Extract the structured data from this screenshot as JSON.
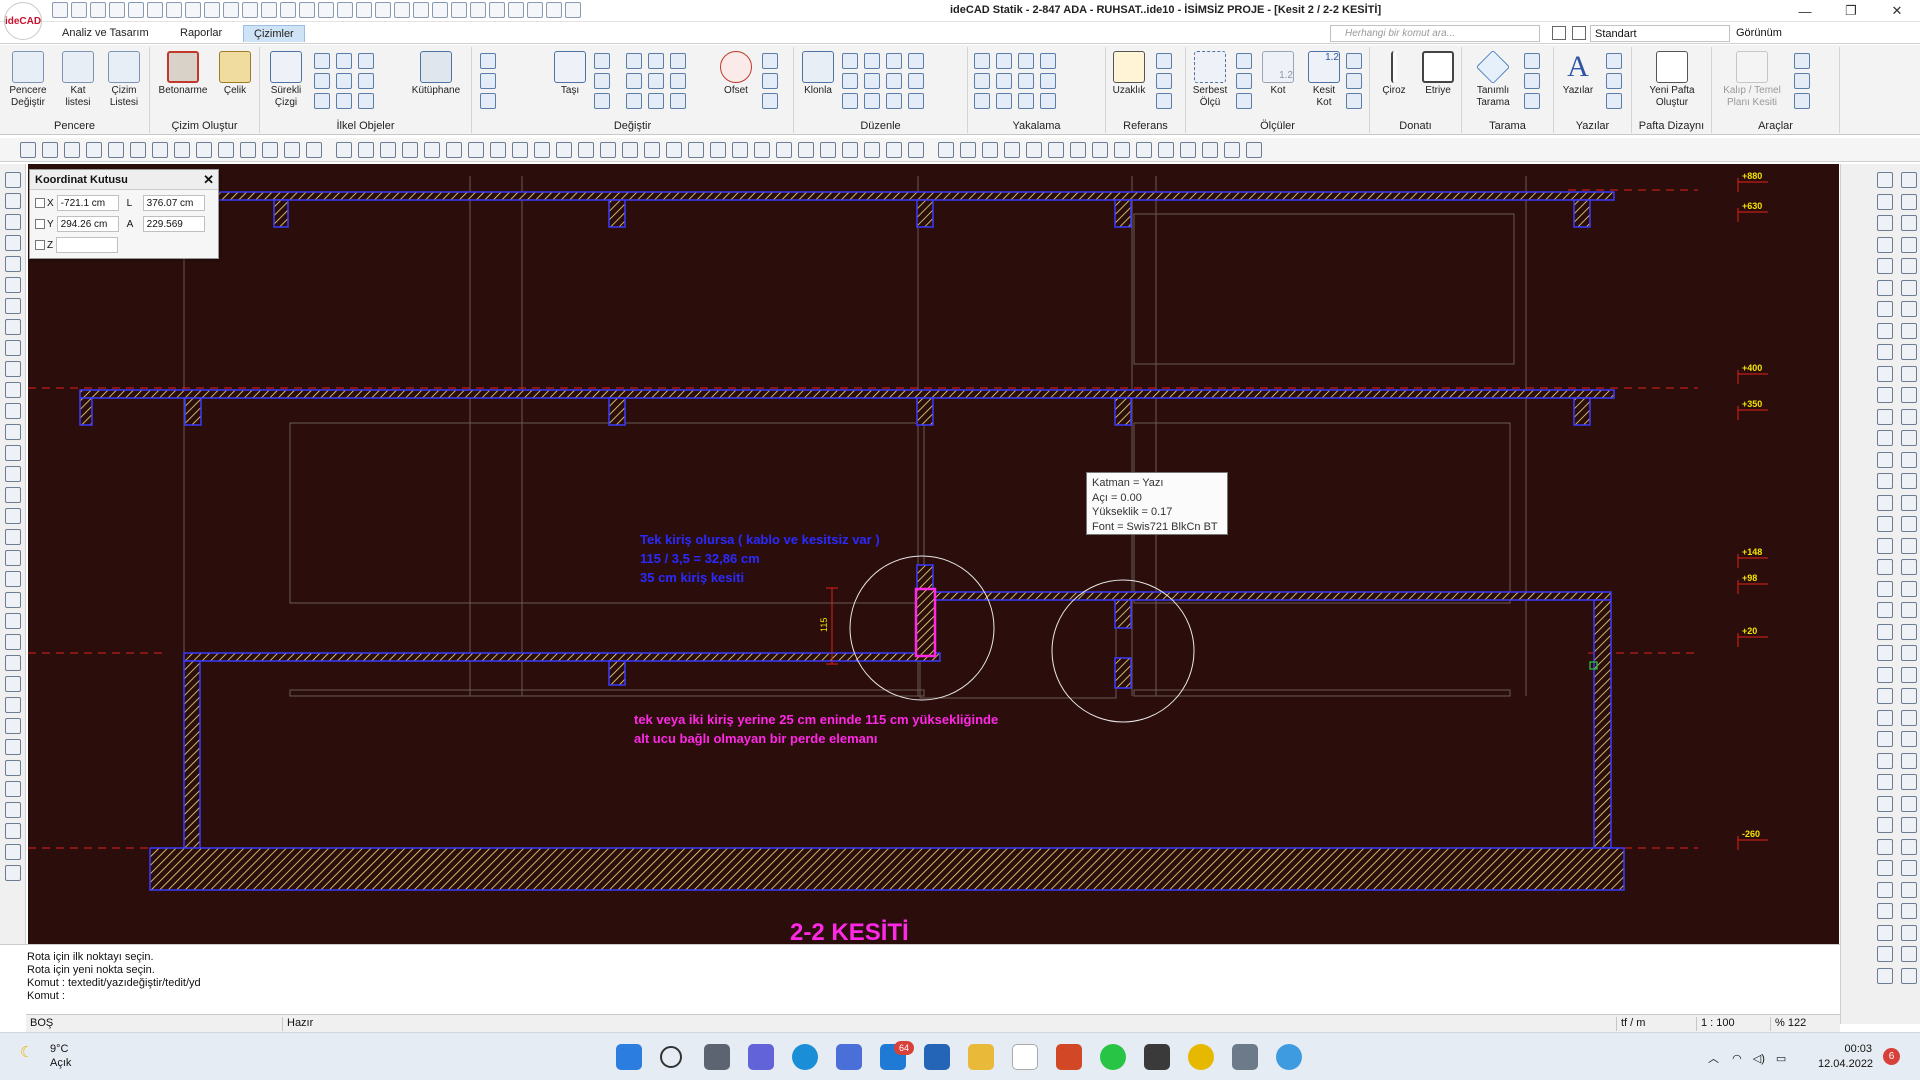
{
  "app": {
    "logo_text": "ideCAD",
    "window_title": "ideCAD Statik - 2-847 ADA - RUHSAT..ide10 - İSİMSİZ PROJE - [Kesit 2 / 2-2 KESİTİ]",
    "win_controls": {
      "minimize": "—",
      "restore": "❐",
      "close": "✕"
    }
  },
  "menu": {
    "tabs": [
      "Analiz ve Tasarım",
      "Raporlar",
      "Çizimler"
    ],
    "active": "Çizimler",
    "search_placeholder": "Herhangi bir komut ara...",
    "style_select": "Standart",
    "view_menu": "Görünüm"
  },
  "ribbon": {
    "groups": [
      {
        "label": "Pencere",
        "buttons": [
          "Pencere Değiştir",
          "Kat listesi",
          "Çizim Listesi"
        ]
      },
      {
        "label": "Çizim Oluştur",
        "buttons": [
          "Betonarme",
          "Çelik"
        ]
      },
      {
        "label": "İlkel Objeler",
        "buttons": [
          "Sürekli Çizgi",
          "Kütüphane"
        ]
      },
      {
        "label": "Değiştir",
        "buttons": [
          "Taşı",
          "Ofset"
        ]
      },
      {
        "label": "Düzenle",
        "buttons": [
          "Klonla"
        ]
      },
      {
        "label": "Yakalama",
        "buttons": []
      },
      {
        "label": "Referans",
        "buttons": [
          "Uzaklık"
        ]
      },
      {
        "label": "Ölçüler",
        "buttons": [
          "Serbest Ölçü",
          "Kot",
          "Kesit Kot"
        ]
      },
      {
        "label": "Donatı",
        "buttons": [
          "Çiroz",
          "Etriye"
        ]
      },
      {
        "label": "Tarama",
        "buttons": [
          "Tanımlı Tarama"
        ]
      },
      {
        "label": "Yazılar",
        "buttons": [
          "Yazılar"
        ]
      },
      {
        "label": "Pafta Dizaynı",
        "buttons": [
          "Yeni Pafta Oluştur"
        ]
      },
      {
        "label": "Araçlar",
        "buttons": [
          "Kalıp / Temel Planı Kesiti"
        ]
      }
    ],
    "kot_value": "1.2"
  },
  "coord_box": {
    "title": "Koordinat Kutusu",
    "x_label": "X",
    "x_value": "-721.1 cm",
    "y_label": "Y",
    "y_value": "294.26 cm",
    "z_label": "Z",
    "z_value": "",
    "l_label": "L",
    "l_value": "376.07 cm",
    "a_label": "A",
    "a_value": "229.569"
  },
  "tooltip": {
    "lines": [
      "Katman = Yazı",
      "Açı = 0.00",
      "Yükseklik = 0.17",
      "Font = Swis721 BlkCn BT"
    ]
  },
  "drawing": {
    "colors": {
      "background": "#2b0e0b",
      "hatch_border": "#3a3aff",
      "hatch_fill": "#f0e27a",
      "dim_line": "#e0201a",
      "level_text": "#f5e400",
      "note_blue": "#2a2aff",
      "note_magenta": "#ff28e6",
      "title": "#ff28e6"
    },
    "levels": [
      "+880",
      "+630",
      "+400",
      "+350",
      "+148",
      "+98",
      "+20",
      "-260"
    ],
    "note_blue": [
      "Tek kiriş olursa ( kablo ve kesitsiz var )",
      "115 / 3,5 = 32,86 cm",
      "35 cm kiriş kesiti"
    ],
    "note_magenta": [
      "tek veya iki kiriş yerine 25 cm eninde 115 cm yüksekliğinde",
      "alt ucu bağlı olmayan bir perde elemanı"
    ],
    "dim_value": "115",
    "section_title": "2-2 KESİTİ"
  },
  "command_line": {
    "lines": [
      "Rota için ilk noktayı seçin.",
      "Rota için yeni nokta seçin.",
      "Komut : textedit/yazıdeğiştir/tedit/yd",
      "Komut :"
    ]
  },
  "status_bar": {
    "layer": "BOŞ",
    "state": "Hazır",
    "units": "tf / m",
    "scale": "1 : 100",
    "zoom": "% 122"
  },
  "taskbar": {
    "temperature": "9°C",
    "weather": "Açık",
    "mail_badge": "64",
    "time": "00:03",
    "date": "12.04.2022",
    "notifications": "6"
  }
}
